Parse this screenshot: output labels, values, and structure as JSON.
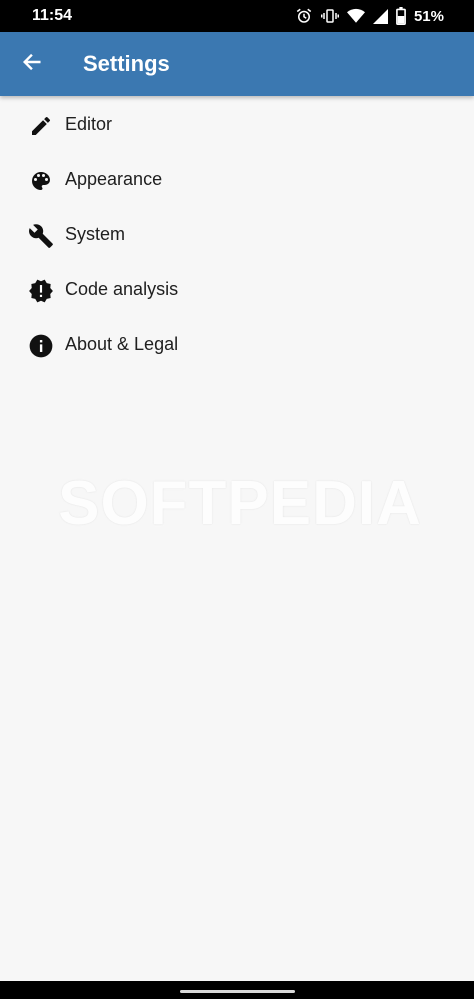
{
  "status_bar": {
    "time": "11:54",
    "battery": "51%",
    "icons": [
      "alarm-icon",
      "vibrate-icon",
      "wifi-icon",
      "signal-icon",
      "battery-icon"
    ]
  },
  "app_bar": {
    "title": "Settings",
    "back_icon": "arrow-back-icon",
    "color": "#3b78b1"
  },
  "menu": {
    "items": [
      {
        "label": "Editor",
        "icon": "pencil-icon"
      },
      {
        "label": "Appearance",
        "icon": "palette-icon"
      },
      {
        "label": "System",
        "icon": "wrench-icon"
      },
      {
        "label": "Code analysis",
        "icon": "alert-decagram-icon"
      },
      {
        "label": "About & Legal",
        "icon": "info-icon"
      }
    ]
  },
  "watermark": "SOFTPEDIA"
}
